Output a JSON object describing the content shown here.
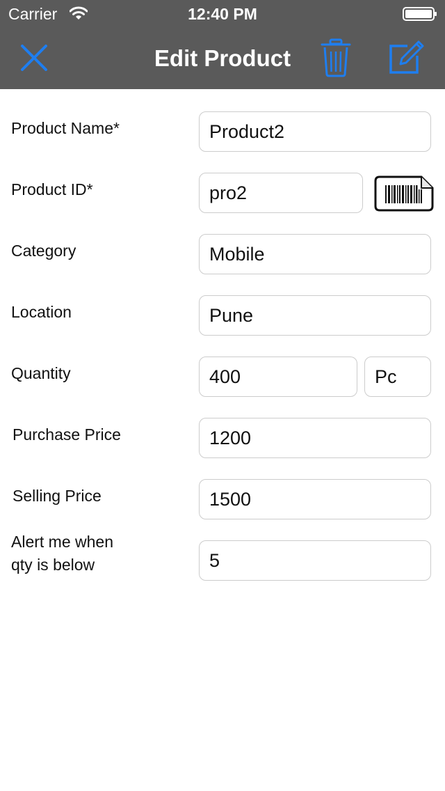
{
  "status_bar": {
    "carrier": "Carrier",
    "time": "12:40 PM"
  },
  "nav": {
    "title": "Edit Product",
    "left_icon": "close-icon",
    "right_icons": [
      "trash-icon",
      "edit-icon"
    ],
    "accent_color": "#1e7ef0",
    "bar_color": "#5a5a5a"
  },
  "form": {
    "product_name": {
      "label": "Product Name*",
      "value": "Product2"
    },
    "product_id": {
      "label": "Product ID*",
      "value": "pro2",
      "scan_icon": "barcode-icon"
    },
    "category": {
      "label": "Category",
      "value": "Mobile"
    },
    "location": {
      "label": "Location",
      "value": "Pune"
    },
    "quantity": {
      "label": "Quantity",
      "value": "400",
      "unit": "Pc"
    },
    "purchase_price": {
      "label": "Purchase Price",
      "value": "1200"
    },
    "selling_price": {
      "label": "Selling Price",
      "value": "1500"
    },
    "alert_qty": {
      "label_line1": "Alert me when",
      "label_line2": "qty is below",
      "value": "5"
    }
  }
}
